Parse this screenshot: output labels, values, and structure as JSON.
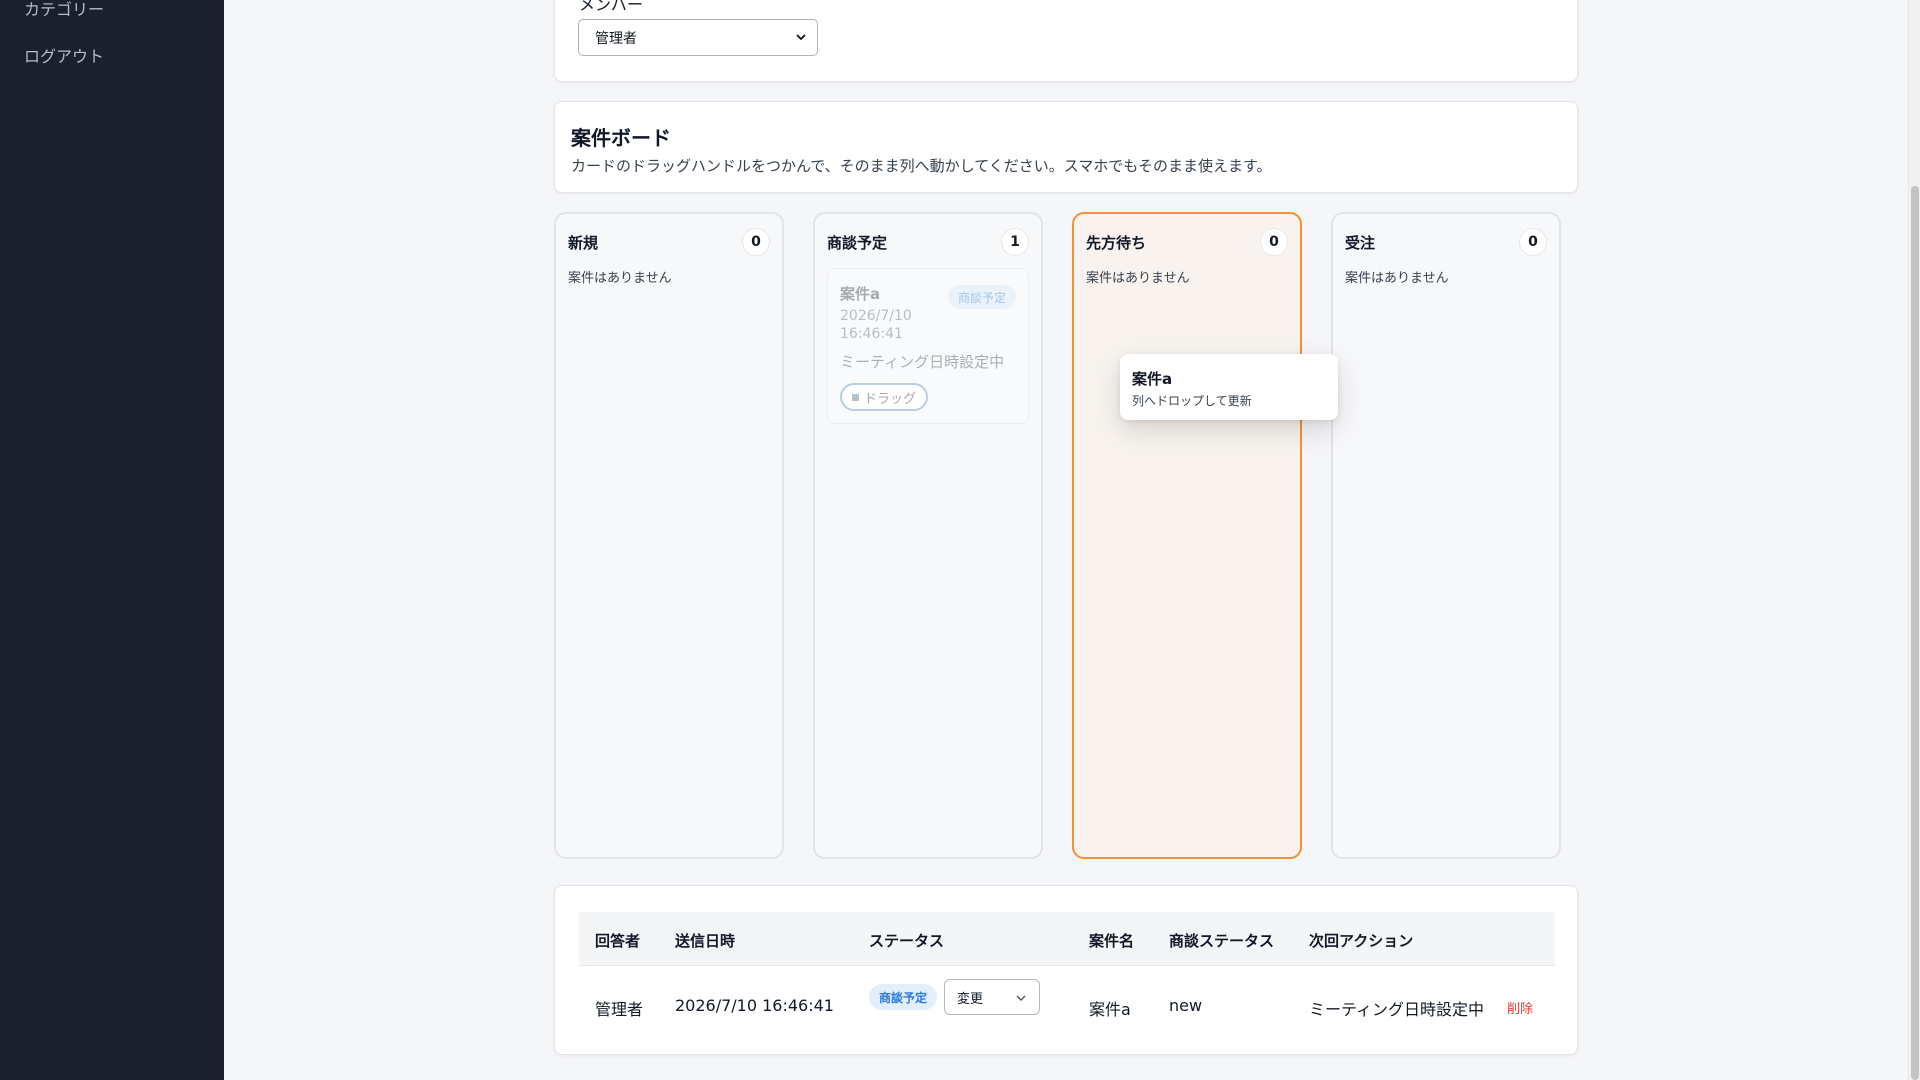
{
  "sidebar": {
    "items": [
      {
        "label": "カテゴリー"
      },
      {
        "label": "ログアウト"
      }
    ]
  },
  "member_filter": {
    "label": "メンバー",
    "selected": "管理者"
  },
  "board": {
    "title": "案件ボード",
    "description": "カードのドラッグハンドルをつかんで、そのまま列へ動かしてください。スマホでもそのまま使えます。",
    "columns": [
      {
        "title": "新規",
        "count": "0",
        "empty_text": "案件はありません"
      },
      {
        "title": "商談予定",
        "count": "1"
      },
      {
        "title": "先方待ち",
        "count": "0",
        "empty_text": "案件はありません"
      },
      {
        "title": "受注",
        "count": "0",
        "empty_text": "案件はありません"
      }
    ],
    "deal_card": {
      "name": "案件a",
      "date": "2026/7/10 16:46:41",
      "badge": "商談予定",
      "next_action": "ミーティング日時設定中",
      "drag_label": "ドラッグ"
    },
    "drag_ghost": {
      "title": "案件a",
      "hint": "列へドロップして更新"
    }
  },
  "table": {
    "headers": [
      "回答者",
      "送信日時",
      "ステータス",
      "案件名",
      "商談ステータス",
      "次回アクション"
    ],
    "rows": [
      {
        "respondent": "管理者",
        "sent_at": "2026/7/10 16:46:41",
        "status": "商談予定",
        "status_select": "変更",
        "deal_name": "案件a",
        "deal_status": "new",
        "next_action": "ミーティング日時設定中",
        "delete_label": "削除"
      }
    ]
  },
  "colors": {
    "sidebar_bg": "#1b1f2e",
    "active_column_border": "#f5922f",
    "status_badge_text": "#2d7bd8",
    "delete": "#e53935"
  }
}
